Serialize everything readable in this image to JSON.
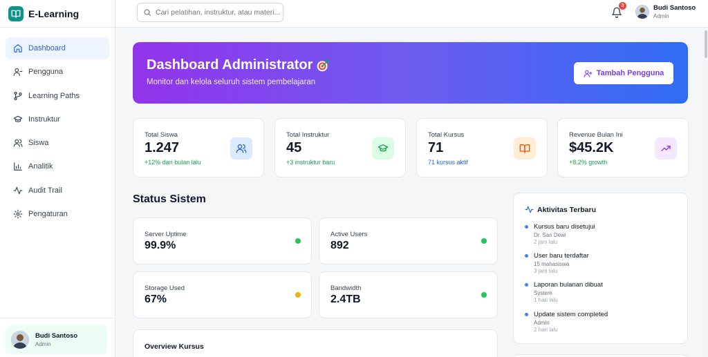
{
  "app": {
    "name": "E-Learning"
  },
  "sidebar": {
    "items": [
      {
        "label": "Dashboard",
        "icon": "home-icon",
        "active": true
      },
      {
        "label": "Pengguna",
        "icon": "user-icon"
      },
      {
        "label": "Learning Paths",
        "icon": "git-branch-icon"
      },
      {
        "label": "Instruktur",
        "icon": "graduation-cap-icon"
      },
      {
        "label": "Siswa",
        "icon": "users-icon"
      },
      {
        "label": "Analitik",
        "icon": "bar-chart-icon"
      },
      {
        "label": "Audit Trail",
        "icon": "activity-icon"
      },
      {
        "label": "Pengaturan",
        "icon": "gear-icon"
      }
    ],
    "user": {
      "name": "Budi Santoso",
      "role": "Admin"
    }
  },
  "header": {
    "search_placeholder": "Cari pelatihan, instruktur, atau materi...",
    "notification_count": "3",
    "user": {
      "name": "Budi Santoso",
      "role": "Admin"
    }
  },
  "hero": {
    "title": "Dashboard Administrator",
    "subtitle": "Monitor dan kelola seluruh sistem pembelajaran",
    "button_label": "Tambah Pengguna"
  },
  "stats": [
    {
      "label": "Total Siswa",
      "value": "1.247",
      "note": "+12% dari bulan lalu",
      "note_color": "#16a34a",
      "icon": "users-icon",
      "icon_bg": "#dbeafe",
      "icon_color": "#2563eb"
    },
    {
      "label": "Total Instruktur",
      "value": "45",
      "note": "+3 instruktur baru",
      "note_color": "#16a34a",
      "icon": "graduation-cap-icon",
      "icon_bg": "#dcfce7",
      "icon_color": "#16a34a"
    },
    {
      "label": "Total Kursus",
      "value": "71",
      "note": "71 kursus aktif",
      "note_color": "#2563eb",
      "icon": "book-open-icon",
      "icon_bg": "#ffedd5",
      "icon_color": "#ea580c"
    },
    {
      "label": "Revenue Bulan Ini",
      "value": "$45.2K",
      "note": "+8.2% growth",
      "note_color": "#16a34a",
      "icon": "trending-up-icon",
      "icon_bg": "#f3e8ff",
      "icon_color": "#9333ea"
    }
  ],
  "system": {
    "title": "Status Sistem",
    "items": [
      {
        "label": "Server Uptime",
        "value": "99.9%",
        "status_color": "#22c55e"
      },
      {
        "label": "Active Users",
        "value": "892",
        "status_color": "#22c55e"
      },
      {
        "label": "Storage Used",
        "value": "67%",
        "status_color": "#eab308"
      },
      {
        "label": "Bandwidth",
        "value": "2.4TB",
        "status_color": "#22c55e"
      }
    ]
  },
  "overview": {
    "title": "Overview Kursus"
  },
  "activity": {
    "title": "Aktivitas Terbaru",
    "items": [
      {
        "title": "Kursus baru disetujui",
        "sub": "Dr. Sari Dewi",
        "time": "2 jam lalu"
      },
      {
        "title": "User baru terdaftar",
        "sub": "15 mahasiswa",
        "time": "3 jam lalu"
      },
      {
        "title": "Laporan bulanan dibuat",
        "sub": "System",
        "time": "1 hari lalu"
      },
      {
        "title": "Update sistem completed",
        "sub": "Admin",
        "time": "2 hari lalu"
      }
    ]
  }
}
